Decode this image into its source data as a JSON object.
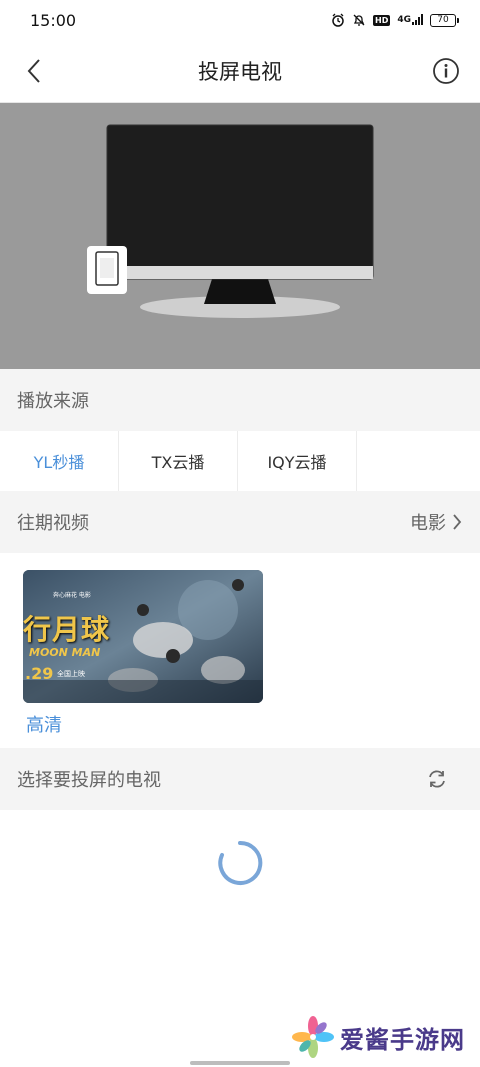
{
  "status_bar": {
    "time": "15:00",
    "hd_label": "HD",
    "signal_label": "4G",
    "battery": "70"
  },
  "header": {
    "title": "投屏电视"
  },
  "sources": {
    "title": "播放来源",
    "tabs": [
      {
        "label": "YL秒播",
        "active": true
      },
      {
        "label": "TX云播",
        "active": false
      },
      {
        "label": "IQY云播",
        "active": false
      }
    ]
  },
  "history": {
    "title": "往期视频",
    "more_label": "电影",
    "videos": [
      {
        "poster_top": "奔心麻花 电影",
        "poster_title": "行月球",
        "poster_subtitle": "MOON MAN",
        "poster_date": ".29",
        "poster_release": "全国上映",
        "quality": "高清"
      }
    ]
  },
  "tv_select": {
    "title": "选择要投屏的电视"
  },
  "watermark": {
    "text": "爱酱手游网"
  },
  "colors": {
    "accent": "#4a8fd9",
    "section_bg": "#f4f4f4",
    "tv_area_bg": "#9a9a9a"
  }
}
